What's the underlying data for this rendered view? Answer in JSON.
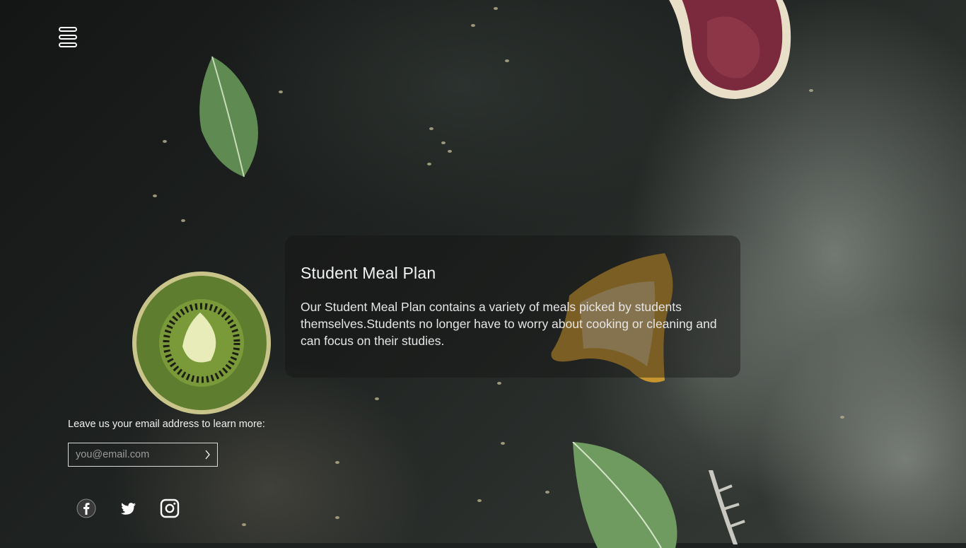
{
  "header": {
    "menu_icon": "menu-icon"
  },
  "card": {
    "title": "Student Meal Plan",
    "description": "Our Student Meal Plan contains a variety of meals picked by students themselves.Students no longer have to worry about cooking or cleaning and can focus on their studies."
  },
  "signup": {
    "label": "Leave us your email address to learn more:",
    "placeholder": "you@email.com",
    "value": "",
    "submit_icon": "chevron-right-icon"
  },
  "social": [
    {
      "name": "facebook-icon"
    },
    {
      "name": "twitter-icon"
    },
    {
      "name": "instagram-icon"
    }
  ],
  "colors": {
    "accent": "#ffffff",
    "card_bg": "#141414"
  }
}
